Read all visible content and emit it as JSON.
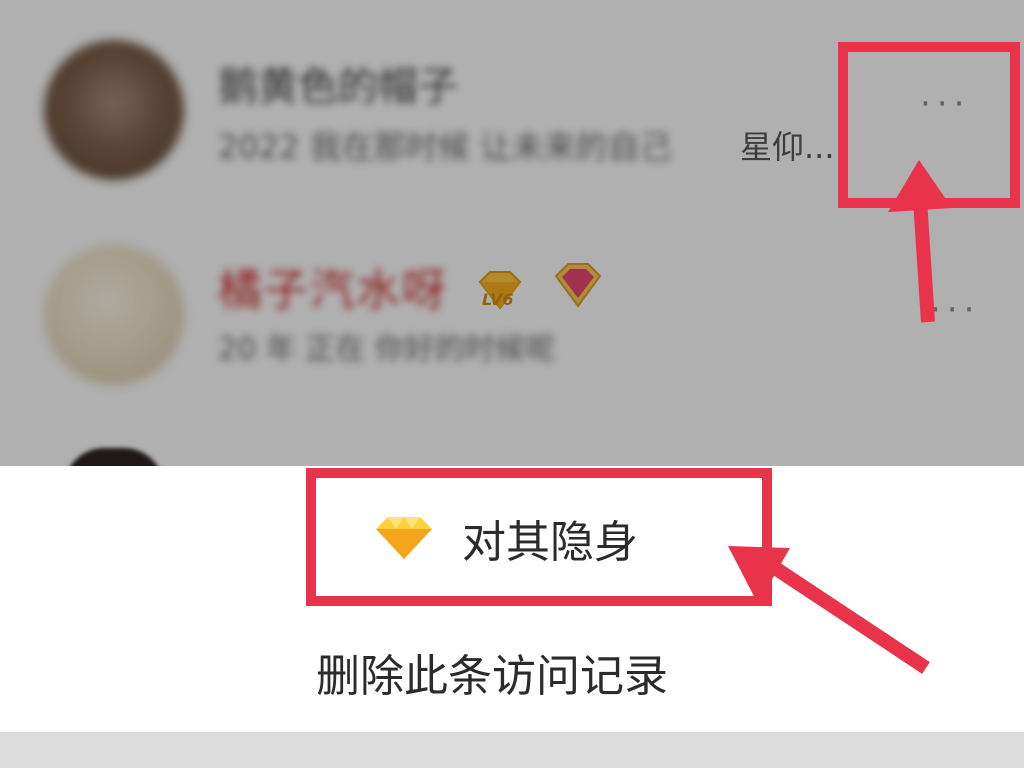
{
  "visitors": [
    {
      "name": "鹅黄色的帽子",
      "message": "2022 我在那时候 让未来的自己",
      "message_tail": "星仰...",
      "more_label": "···"
    },
    {
      "name": "橘子汽水呀",
      "message": "20 年 正在 你好的时候呢",
      "level_badge": "LV6",
      "more_label": "···"
    }
  ],
  "action_sheet": {
    "invisible_label": "对其隐身",
    "delete_label": "删除此条访问记录",
    "gem_icon": "diamond-icon"
  },
  "annotation_color": "#e8334a"
}
